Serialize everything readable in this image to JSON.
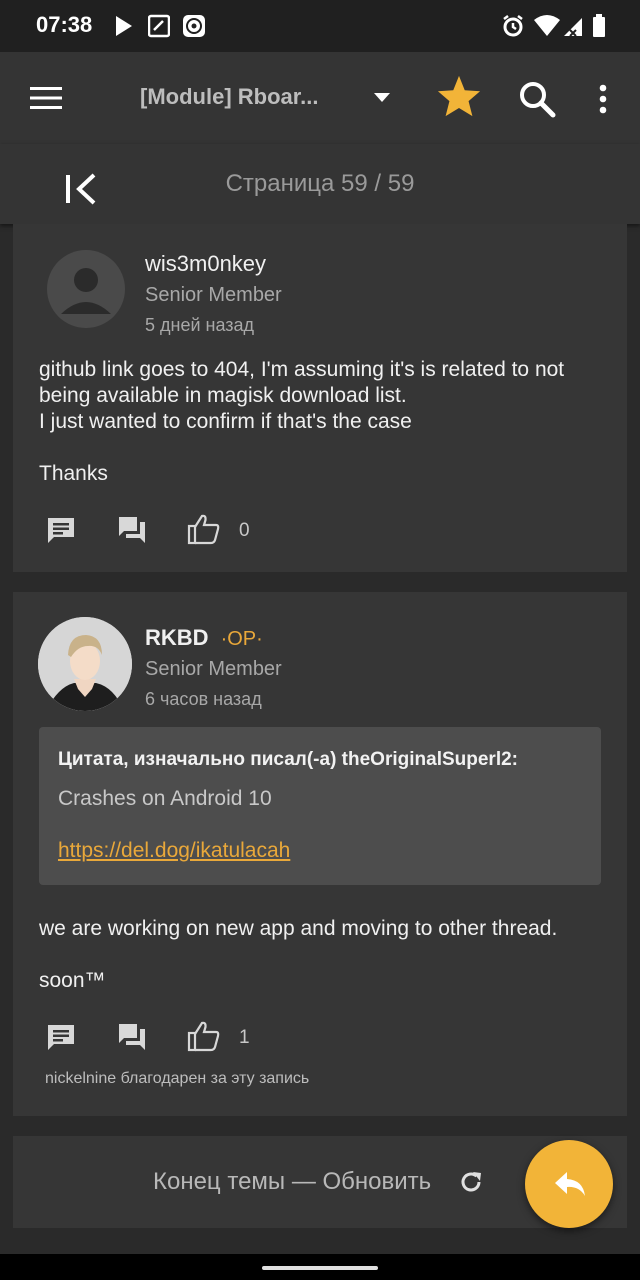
{
  "status_bar": {
    "time": "07:38"
  },
  "app_bar": {
    "title": "[Module] Rboar..."
  },
  "pagination": {
    "text": "Страница 59 / 59"
  },
  "posts": [
    {
      "username": "wis3m0nkey",
      "role": "Senior Member",
      "time": "5 дней назад",
      "body": [
        "github link goes to 404, I'm assuming it's is related to not",
        "being available in magisk download list.",
        "I just wanted to confirm if that's the case",
        "Thanks"
      ],
      "likes": "0"
    },
    {
      "username": "RKBD",
      "badge": "·OP·",
      "role": "Senior Member",
      "time": "6 часов назад",
      "quote": {
        "header": "Цитата, изначально писал(-а) theOriginalSuperl2:",
        "text": "Crashes on Android 10",
        "link": "https://del.dog/ikatulacah"
      },
      "body": [
        "we are working on new app and moving to other thread.",
        "soon™"
      ],
      "likes": "1",
      "thanks_note": "nickelnine благодарен за эту запись"
    }
  ],
  "footer": {
    "end_text": "Конец темы — Обновить"
  },
  "colors": {
    "accent": "#f2b438",
    "background": "#2a2a2a",
    "card": "#363636"
  }
}
